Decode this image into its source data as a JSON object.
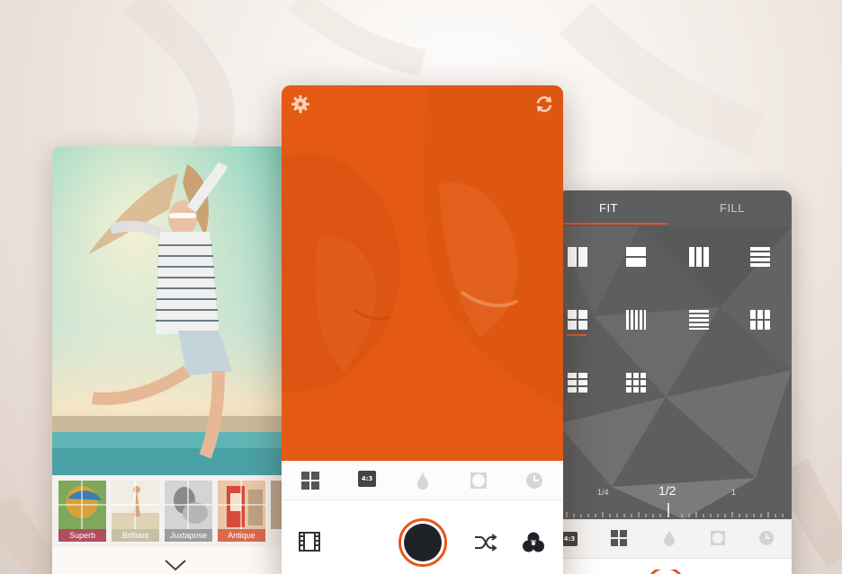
{
  "left_screen": {
    "filters": [
      {
        "label": "Superb",
        "color": "#b04d5f"
      },
      {
        "label": "Brilliant",
        "color": "#c8bfa4"
      },
      {
        "label": "Juxtapose",
        "color": "#9d9d9d"
      },
      {
        "label": "Antique",
        "color": "#d96a4e"
      }
    ],
    "chevron_icon": "chevron-down-icon"
  },
  "center_screen": {
    "overlay_color": "#e45a15",
    "top_icons": [
      "gear-icon",
      "rotate-icon"
    ],
    "toolbar": {
      "ratio_badge": "4:3",
      "icons": [
        "grid-icon",
        "ratio-icon",
        "drop-icon",
        "vignette-icon",
        "timer-icon"
      ]
    },
    "capture_icons": [
      "film-icon",
      "shutter-button",
      "shuffle-icon",
      "color-circles-icon"
    ]
  },
  "right_screen": {
    "tabs": [
      "FIT",
      "FILL"
    ],
    "active_tab": "FIT",
    "ratio": {
      "left": "1/4",
      "current": "1/2",
      "right": "1"
    },
    "toolbar": {
      "ratio_badge": "4:3",
      "icons": [
        "ratio-icon",
        "grid-icon",
        "drop-icon",
        "vignette-icon",
        "timer-icon"
      ]
    },
    "accent": "#e8561b"
  }
}
